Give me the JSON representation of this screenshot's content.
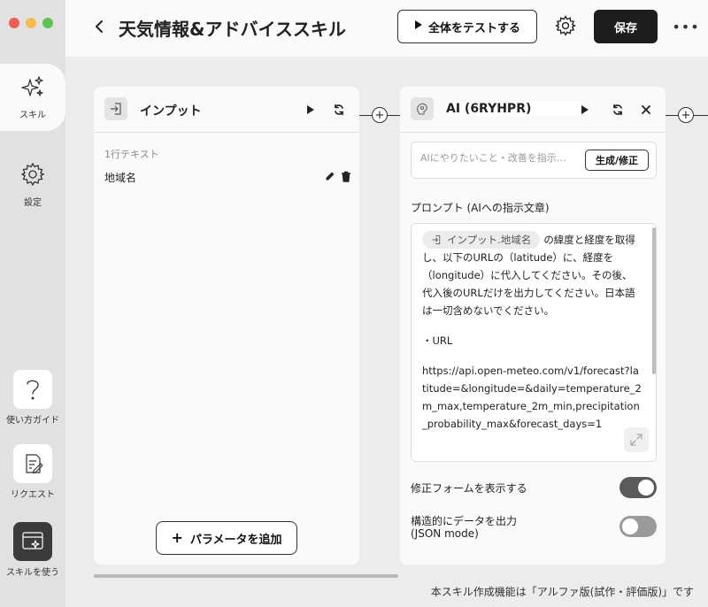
{
  "window": {
    "traffic_lights": [
      "#ee5f57",
      "#f4bd4f",
      "#5fc454"
    ]
  },
  "sidebar": {
    "skill_label": "スキル",
    "settings_label": "設定",
    "guide_label": "使い方ガイド",
    "request_label": "リクエスト",
    "use_skill_label": "スキルを使う"
  },
  "header": {
    "title": "天気情報&アドバイススキル",
    "test_all_label": "全体をテストする",
    "save_label": "保存"
  },
  "input_card": {
    "title": "インプット",
    "param_type": "1行テキスト",
    "param_name": "地域名",
    "add_param_label": "パラメータを追加"
  },
  "ai_card": {
    "title": "AI (6RYHPR)",
    "instruction_placeholder": "AIにやりたいこと・改善を指示…",
    "generate_label": "生成/修正",
    "prompt_label": "プロンプト (AIへの指示文章)",
    "prompt": {
      "chip_label": "インプット.地域名",
      "paragraph1": "の緯度と経度を取得し、以下のURLの（latitude）に、経度を（longitude）に代入してください。その後、代入後のURLだけを出力してください。日本語は一切含めないでください。",
      "paragraph2": "・URL",
      "url": "https://api.open-meteo.com/v1/forecast?latitude=&longitude=&daily=temperature_2m_max,temperature_2m_min,precipitation_probability_max&forecast_days=1"
    },
    "toggle_form_label": "修正フォームを表示する",
    "toggle_form_on": true,
    "toggle_json_label_line1": "構造的にデータを出力",
    "toggle_json_label_line2": "(JSON mode)",
    "toggle_json_on": false
  },
  "footer_note": "本スキル作成機能は「アルファ版(試作・評価版)」です"
}
